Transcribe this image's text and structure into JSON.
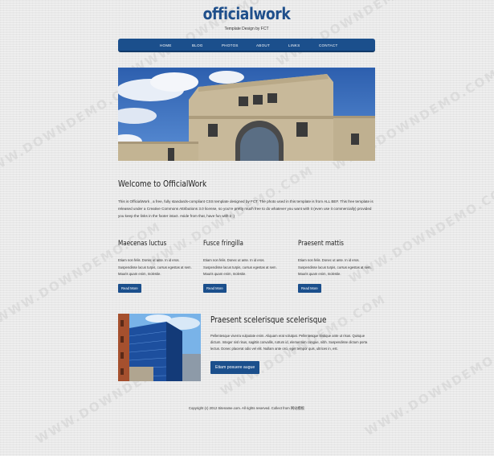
{
  "site": {
    "logo": "officialwork",
    "tagline": "Template Design by FCT"
  },
  "nav": {
    "items": [
      {
        "label": "HOME"
      },
      {
        "label": "BLOG"
      },
      {
        "label": "PHOTOS"
      },
      {
        "label": "ABOUT"
      },
      {
        "label": "LINKS"
      },
      {
        "label": "CONTACT"
      }
    ]
  },
  "welcome": {
    "heading": "Welcome to OfficialWork",
    "text": "This is OfficialWork , a free, fully standards-compliant CSS template designed by FCT. The photo used in this template is from ALL BEF. This free template is released under a Creative Commons Attributions 3.0 license, so you're pretty much free to do whatever you want with it (even use it commercially) provided you keep the links in the footer intact. Aside from that, have fun with it :)"
  },
  "columns": [
    {
      "title": "Maecenas luctus",
      "text": "Etiam non felis. Donec ut ante. In id eros. Suspendisse lacus turpis, cursus egestas at sem. Mauris quam enim, molestie.",
      "button": "Read More"
    },
    {
      "title": "Fusce fringilla",
      "text": "Etiam non felis. Donec ut ante. In id eros. Suspendisse lacus turpis, cursus egestas at sem. Mauris quam enim, molestie.",
      "button": "Read More"
    },
    {
      "title": "Praesent mattis",
      "text": "Etiam non felis. Donec ut ante. In id eros. Suspendisse lacus turpis, cursus egestas at sem. Mauris quam enim, molestie.",
      "button": "Read More"
    }
  ],
  "feature": {
    "title": "Praesent scelerisque scelerisque",
    "text": "Pellentesque viverra vulputate enim. Aliquam erat volutpat. Pellentesque tristique ante ut risus. Quisque dictum. Integer nisl risus, sagittis convallis, rutrum id, elementum congue, nibh. Suspendisse dictum porta lectus. Donec placerat odio vel elit. Nullam ante orci, eget tempor quis, ultrices in, est.",
    "button": "Etiam posuere augue"
  },
  "footer": {
    "text": "Copyright (c) 2012 Sitename.com. All rights reserved. Collect from 网站模板"
  },
  "watermark": "WWW.DOWNDEMO.COM",
  "colors": {
    "brand_blue": "#1b4f8c",
    "logo_blue": "#1f4f8b",
    "background": "#e9e9e9"
  }
}
